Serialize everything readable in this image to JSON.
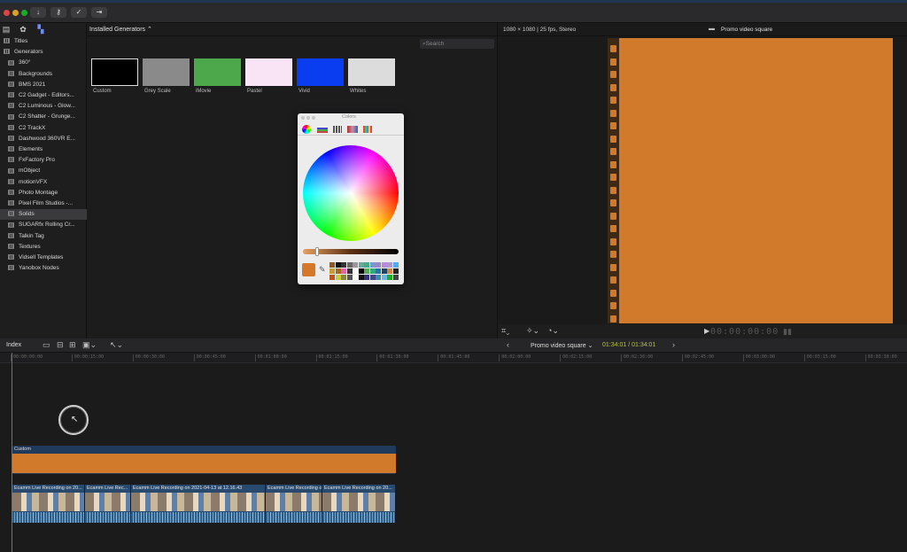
{
  "sidebar": {
    "items": [
      {
        "label": "Titles"
      },
      {
        "label": "Generators"
      },
      {
        "label": "360°"
      },
      {
        "label": "Backgrounds"
      },
      {
        "label": "BMS 2021"
      },
      {
        "label": "C2 Gadget - Editors..."
      },
      {
        "label": "C2 Luminous - Glow..."
      },
      {
        "label": "C2 Shatter - Grunge..."
      },
      {
        "label": "C2 TrackX"
      },
      {
        "label": "Dashwood 360VR E..."
      },
      {
        "label": "Elements"
      },
      {
        "label": "FxFactory Pro"
      },
      {
        "label": "mObject"
      },
      {
        "label": "motionVFX"
      },
      {
        "label": "Photo Montage"
      },
      {
        "label": "Pixel Film Studios -..."
      },
      {
        "label": "Solids"
      },
      {
        "label": "SUGARfx Rolling Cr..."
      },
      {
        "label": "Talkin Tag"
      },
      {
        "label": "Textures"
      },
      {
        "label": "Vidsell Templates"
      },
      {
        "label": "Yanobox Nodes"
      }
    ],
    "selected": "Solids"
  },
  "browser": {
    "title": "Installed Generators ⌃",
    "search_placeholder": "Search",
    "thumbnails": [
      {
        "label": "Custom",
        "color": "#000000"
      },
      {
        "label": "Grey Scale",
        "color": "#8a8a8a"
      },
      {
        "label": "iMovie",
        "color": "#4ca84a"
      },
      {
        "label": "Pastel",
        "color": "#f8e4f4"
      },
      {
        "label": "Vivid",
        "color": "#0a3cf0"
      },
      {
        "label": "Whites",
        "color": "#dcdcdc"
      }
    ]
  },
  "colors_panel": {
    "title": "Colors",
    "selected_color": "#d6782a"
  },
  "viewer": {
    "format": "1080 × 1080 | 25 fps, Stereo",
    "title": "Promo video square",
    "timecode": "00:00:00:00",
    "frame_color": "#d27a2c"
  },
  "timeline": {
    "index_label": "Index",
    "project_title": "Promo video square ⌄",
    "project_timecode": "01:34:01 / 01:34:01",
    "ruler_ticks": [
      "00:00:00:00",
      "00:00:15:00",
      "00:00:30:00",
      "00:00:45:00",
      "00:01:00:00",
      "00:01:15:00",
      "00:01:30:00",
      "00:01:45:00",
      "00:02:00:00",
      "00:02:15:00",
      "00:02:30:00",
      "00:02:45:00",
      "00:03:00:00",
      "00:03:15:00",
      "00:03:30:00"
    ],
    "generator_clip": {
      "label": "Custom",
      "color": "#d27a2c"
    },
    "video_clips": [
      {
        "label": "Ecamm Live Recording on 20..."
      },
      {
        "label": "Ecamm Live Rec..."
      },
      {
        "label": "Ecamm Live Recording on 2021-04-13 at 12.16.43"
      },
      {
        "label": "Ecamm Live Recording on..."
      },
      {
        "label": "Ecamm Live Recording on 20..."
      }
    ]
  }
}
